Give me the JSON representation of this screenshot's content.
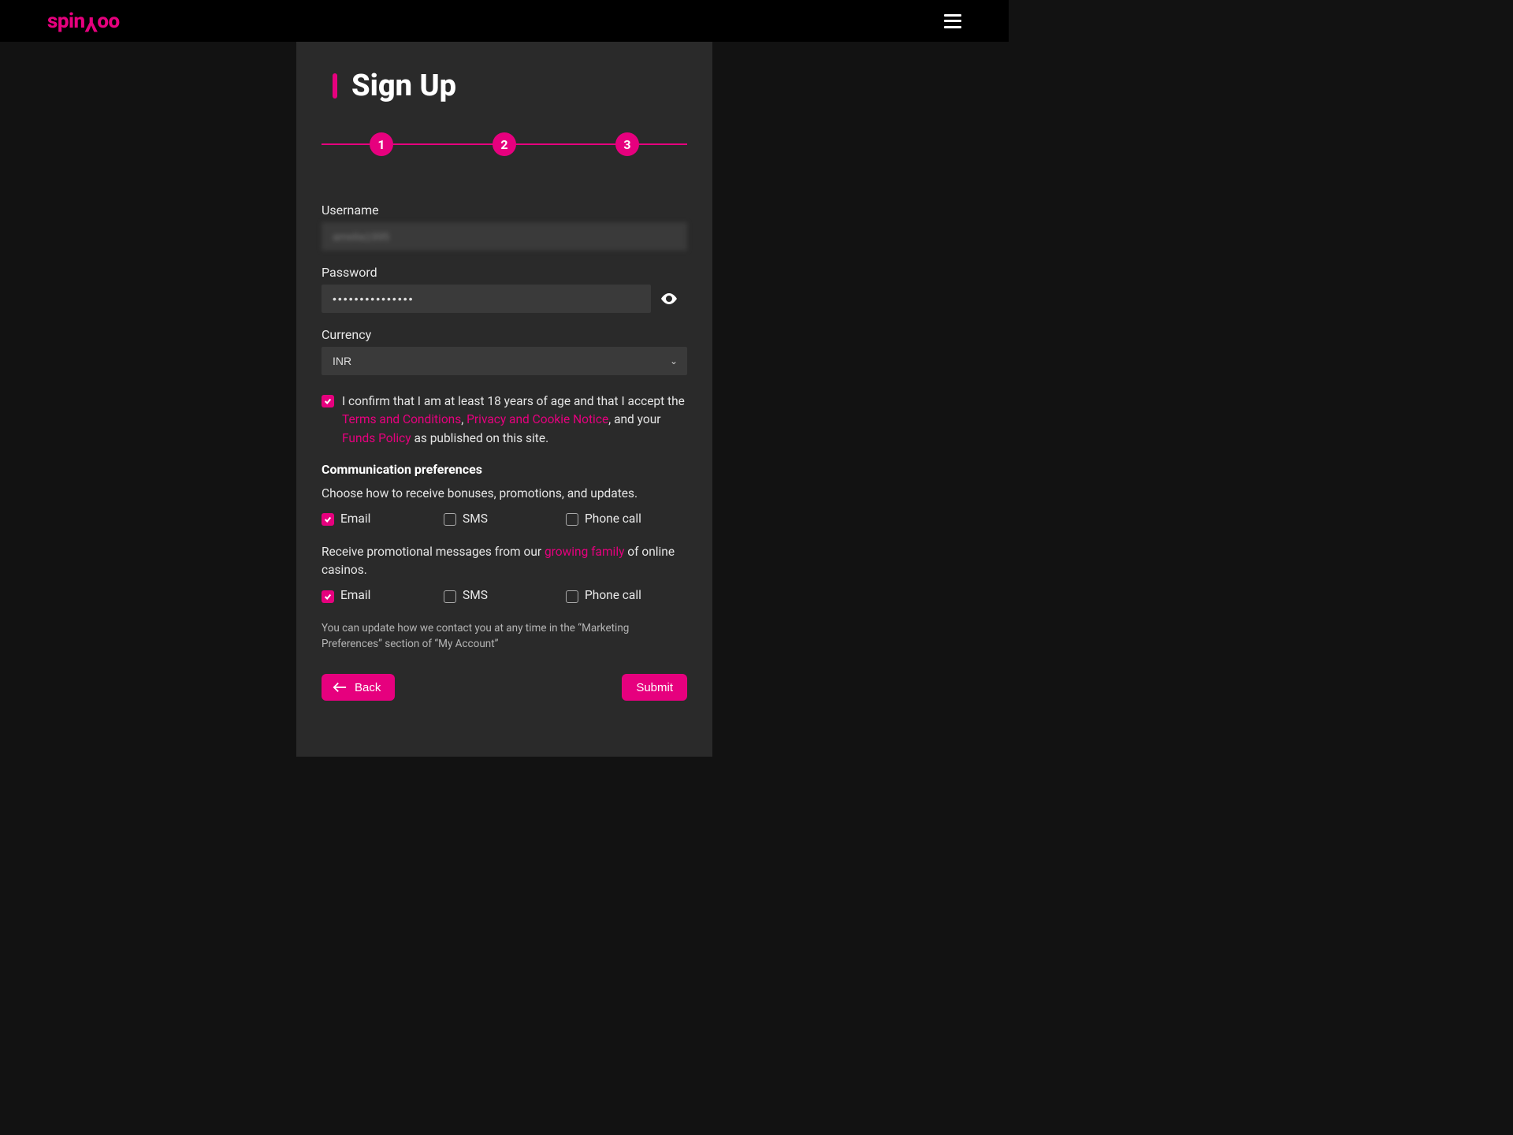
{
  "brand": "spinYoo",
  "title": "Sign Up",
  "stepper": {
    "steps": [
      "1",
      "2",
      "3"
    ]
  },
  "fields": {
    "username_label": "Username",
    "username_value": "amelia1995",
    "password_label": "Password",
    "password_value": "•••••••••••••••",
    "currency_label": "Currency",
    "currency_value": "INR"
  },
  "consent": {
    "pre": "I confirm that I am at least 18 years of age and that I accept the ",
    "tc": "Terms and Conditions",
    "sep1": ", ",
    "privacy": "Privacy and Cookie Notice",
    "sep2": ", and your ",
    "funds": "Funds Policy",
    "post": " as published on this site.",
    "checked": true
  },
  "comm": {
    "heading": "Communication preferences",
    "sub1": "Choose how to receive bonuses, promotions, and updates.",
    "row1": {
      "email": {
        "label": "Email",
        "checked": true
      },
      "sms": {
        "label": "SMS",
        "checked": false
      },
      "phone": {
        "label": "Phone call",
        "checked": false
      }
    },
    "sub2_pre": "Receive promotional messages from our ",
    "sub2_link": "growing family",
    "sub2_post": " of online casinos.",
    "row2": {
      "email": {
        "label": "Email",
        "checked": true
      },
      "sms": {
        "label": "SMS",
        "checked": false
      },
      "phone": {
        "label": "Phone call",
        "checked": false
      }
    },
    "fineprint": "You can update how we contact you at any time in the “Marketing Preferences” section of “My Account”"
  },
  "buttons": {
    "back": "Back",
    "submit": "Submit"
  }
}
